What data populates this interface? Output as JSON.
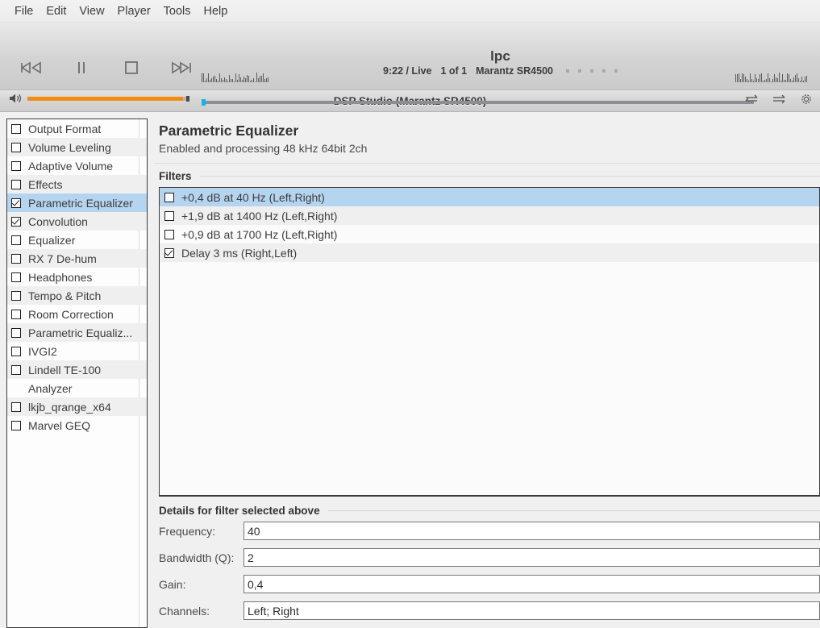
{
  "menubar": {
    "items": [
      {
        "label": "File"
      },
      {
        "label": "Edit"
      },
      {
        "label": "View"
      },
      {
        "label": "Player"
      },
      {
        "label": "Tools"
      },
      {
        "label": "Help"
      }
    ]
  },
  "player": {
    "transport": [
      {
        "name": "previous-track-button",
        "icon": "skip-backward-icon"
      },
      {
        "name": "pause-button",
        "icon": "pause-icon"
      },
      {
        "name": "stop-button",
        "icon": "stop-icon"
      },
      {
        "name": "next-track-button",
        "icon": "skip-forward-icon"
      }
    ],
    "volume": {
      "icon": "speaker-icon",
      "level_percent": 96
    },
    "now_playing": {
      "title": "lpc",
      "time": "9:22 / Live",
      "track_position": "1 of 1",
      "device": "Marantz SR4500",
      "rating_dots": 5
    },
    "seek": {
      "position_percent": 0.5
    },
    "right_buttons": [
      {
        "name": "shuffle-button",
        "icon": "shuffle-icon"
      },
      {
        "name": "continue-button",
        "icon": "arrows-right-icon"
      },
      {
        "name": "settings-button",
        "icon": "gear-icon"
      }
    ]
  },
  "dsp": {
    "window_title": "DSP Studio (Marantz SR4500)"
  },
  "sidebar": {
    "items": [
      {
        "label": "Output Format",
        "checked": false,
        "has_checkbox": true,
        "selected": false
      },
      {
        "label": "Volume Leveling",
        "checked": false,
        "has_checkbox": true,
        "selected": false
      },
      {
        "label": "Adaptive Volume",
        "checked": false,
        "has_checkbox": true,
        "selected": false
      },
      {
        "label": "Effects",
        "checked": false,
        "has_checkbox": true,
        "selected": false
      },
      {
        "label": "Parametric Equalizer",
        "checked": true,
        "has_checkbox": true,
        "selected": true
      },
      {
        "label": "Convolution",
        "checked": true,
        "has_checkbox": true,
        "selected": false
      },
      {
        "label": "Equalizer",
        "checked": false,
        "has_checkbox": true,
        "selected": false
      },
      {
        "label": "RX 7 De-hum",
        "checked": false,
        "has_checkbox": true,
        "selected": false
      },
      {
        "label": "Headphones",
        "checked": false,
        "has_checkbox": true,
        "selected": false
      },
      {
        "label": "Tempo & Pitch",
        "checked": false,
        "has_checkbox": true,
        "selected": false
      },
      {
        "label": "Room Correction",
        "checked": false,
        "has_checkbox": true,
        "selected": false
      },
      {
        "label": "Parametric Equaliz...",
        "checked": false,
        "has_checkbox": true,
        "selected": false
      },
      {
        "label": "IVGI2",
        "checked": false,
        "has_checkbox": true,
        "selected": false
      },
      {
        "label": "Lindell TE-100",
        "checked": false,
        "has_checkbox": true,
        "selected": false
      },
      {
        "label": "Analyzer",
        "checked": false,
        "has_checkbox": false,
        "selected": false
      },
      {
        "label": "lkjb_qrange_x64",
        "checked": false,
        "has_checkbox": true,
        "selected": false
      },
      {
        "label": "Marvel GEQ",
        "checked": false,
        "has_checkbox": true,
        "selected": false
      }
    ]
  },
  "panel": {
    "title": "Parametric Equalizer",
    "subtitle": "Enabled and processing 48 kHz 64bit 2ch",
    "filters_header": "Filters",
    "filters": [
      {
        "label": "+0,4 dB at 40 Hz (Left,Right)",
        "checked": false,
        "selected": true
      },
      {
        "label": "+1,9 dB at 1400 Hz (Left,Right)",
        "checked": false,
        "selected": false
      },
      {
        "label": "+0,9 dB at 1700 Hz (Left,Right)",
        "checked": false,
        "selected": false
      },
      {
        "label": "Delay 3 ms (Right,Left)",
        "checked": true,
        "selected": false
      }
    ],
    "details_header": "Details for filter selected above",
    "details": [
      {
        "label": "Frequency:",
        "value": "40"
      },
      {
        "label": "Bandwidth (Q):",
        "value": "2"
      },
      {
        "label": "Gain:",
        "value": "0,4"
      },
      {
        "label": "Channels:",
        "value": "Left; Right"
      }
    ]
  },
  "colors": {
    "selection": "#b5d4ef",
    "accent_volume": "#f28c12",
    "seek_marker": "#14b4e8",
    "alt_row": "#efefef"
  }
}
